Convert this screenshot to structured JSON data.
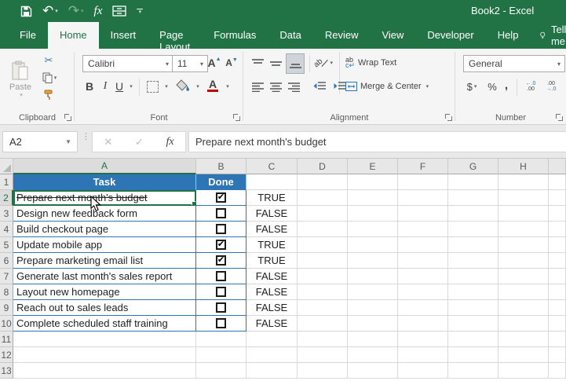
{
  "titlebar": {
    "title": "Book2 - Excel",
    "quick_access": [
      "save-icon",
      "undo-icon",
      "redo-icon",
      "insert-function-icon",
      "touch-mode-icon",
      "customize-toolbar-icon"
    ]
  },
  "tabs": {
    "labels": [
      "File",
      "Home",
      "Insert",
      "Page Layout",
      "Formulas",
      "Data",
      "Review",
      "View",
      "Developer",
      "Help"
    ],
    "active": "Home",
    "tell_me": "Tell me"
  },
  "ribbon": {
    "clipboard": {
      "label": "Clipboard",
      "paste": "Paste"
    },
    "font": {
      "label": "Font",
      "font_name": "Calibri",
      "font_size": "11"
    },
    "alignment": {
      "label": "Alignment",
      "wrap_text": "Wrap Text",
      "merge_center": "Merge & Center"
    },
    "number": {
      "label": "Number",
      "format": "General"
    }
  },
  "formula_bar": {
    "name_box": "A2",
    "formula": "Prepare next month's budget"
  },
  "sheet": {
    "column_letters": [
      "A",
      "B",
      "C",
      "D",
      "E",
      "F",
      "G",
      "H",
      ""
    ],
    "selected_column": "A",
    "selected_cell": "A2",
    "table_headers": {
      "task": "Task",
      "done": "Done"
    },
    "rows": [
      {
        "n": 2,
        "task": "Prepare next month's budget",
        "done": true,
        "value": "TRUE",
        "strikethrough": true,
        "selected": true
      },
      {
        "n": 3,
        "task": "Design new feedback form",
        "done": false,
        "value": "FALSE"
      },
      {
        "n": 4,
        "task": "Build checkout page",
        "done": false,
        "value": "FALSE"
      },
      {
        "n": 5,
        "task": "Update mobile app",
        "done": true,
        "value": "TRUE"
      },
      {
        "n": 6,
        "task": "Prepare marketing email list",
        "done": true,
        "value": "TRUE"
      },
      {
        "n": 7,
        "task": "Generate last month's sales report",
        "done": false,
        "value": "FALSE"
      },
      {
        "n": 8,
        "task": "Layout new homepage",
        "done": false,
        "value": "FALSE"
      },
      {
        "n": 9,
        "task": "Reach out to sales leads",
        "done": false,
        "value": "FALSE"
      },
      {
        "n": 10,
        "task": "Complete scheduled staff training",
        "done": false,
        "value": "FALSE"
      }
    ],
    "visible_row_count": 13
  },
  "colors": {
    "excel_green": "#217346",
    "header_blue": "#2e75b6",
    "selection_green": "#217346",
    "table_border_blue": "#2e75b6"
  }
}
